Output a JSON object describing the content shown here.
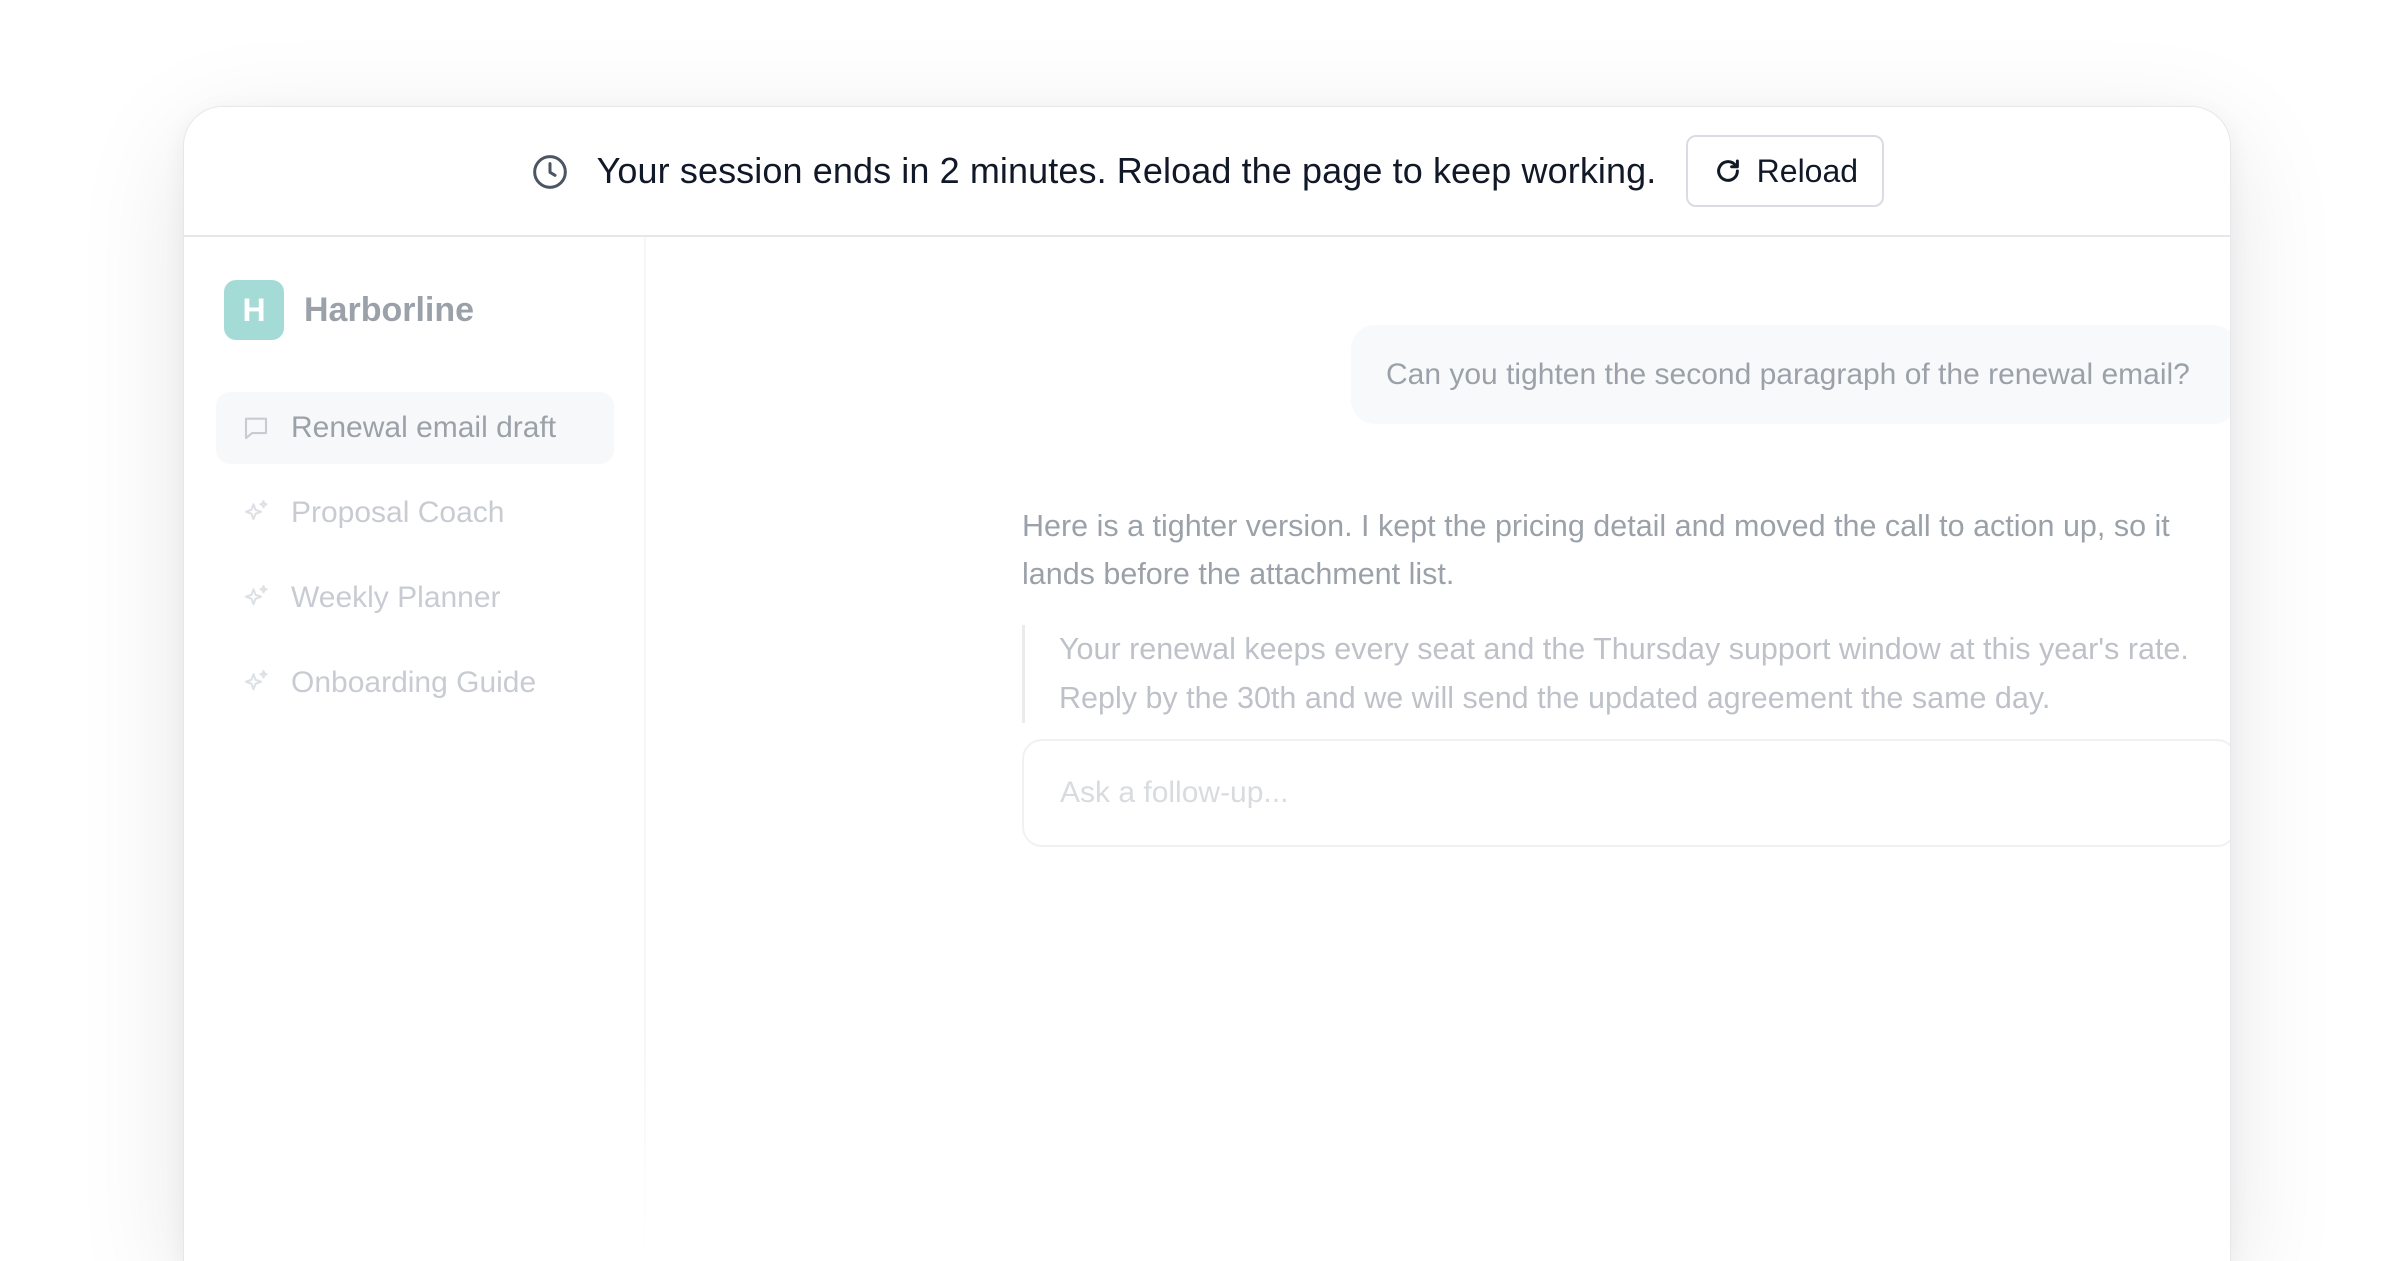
{
  "banner": {
    "message": "Your session ends in 2 minutes. Reload the page to keep working.",
    "reload_label": "Reload",
    "icon": "clock-icon"
  },
  "sidebar": {
    "brand": {
      "initial": "H",
      "name": "Harborline",
      "logo_color": "#24a99b"
    },
    "items": [
      {
        "label": "Renewal email draft",
        "icon": "chat-bubble-icon",
        "active": true
      },
      {
        "label": "Proposal Coach",
        "icon": "sparkle-icon",
        "active": false
      },
      {
        "label": "Weekly Planner",
        "icon": "sparkle-icon",
        "active": false
      },
      {
        "label": "Onboarding Guide",
        "icon": "sparkle-icon",
        "active": false
      }
    ]
  },
  "conversation": {
    "user_message": "Can you tighten the second paragraph of the renewal email?",
    "assistant_message": "Here is a tighter version. I kept the pricing detail and moved the call to action up, so it lands before the attachment list.",
    "assistant_quote": "Your renewal keeps every seat and the Thursday support window at this year's rate. Reply by the 30th and we will send the updated agreement the same day."
  },
  "composer": {
    "placeholder": "Ask a follow-up..."
  }
}
